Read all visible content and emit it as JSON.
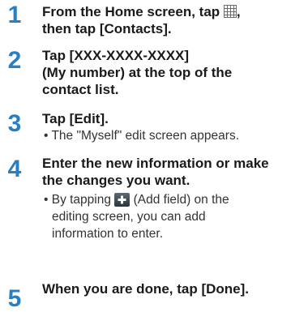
{
  "steps": [
    {
      "number": "1",
      "title_before_icon": "From the Home screen, tap ",
      "title_after_icon": ",",
      "title_line2": "then tap [Contacts].",
      "icon": "apps-grid-icon"
    },
    {
      "number": "2",
      "title_line1": "Tap [XXX-XXXX-XXXX]",
      "title_line2": "(My number) at the top of the",
      "title_line3": "contact list."
    },
    {
      "number": "3",
      "title_line1": "Tap [Edit].",
      "bullet": "• The \"Myself\" edit screen appears."
    },
    {
      "number": "4",
      "title_line1": "Enter the new information or make",
      "title_line2": "the changes you want.",
      "bullet_line1_before_icon": "• By tapping ",
      "bullet_line1_after_icon": " (Add field) on the",
      "bullet_line2": "editing screen, you can add",
      "bullet_line3": "information to enter.",
      "icon": "add-field-icon"
    },
    {
      "number": "5",
      "title_line1": "When you are done, tap [Done]."
    }
  ],
  "colors": {
    "step_number": "#2a7ec2",
    "title_text": "#1a1a1a",
    "body_text": "#333333"
  }
}
